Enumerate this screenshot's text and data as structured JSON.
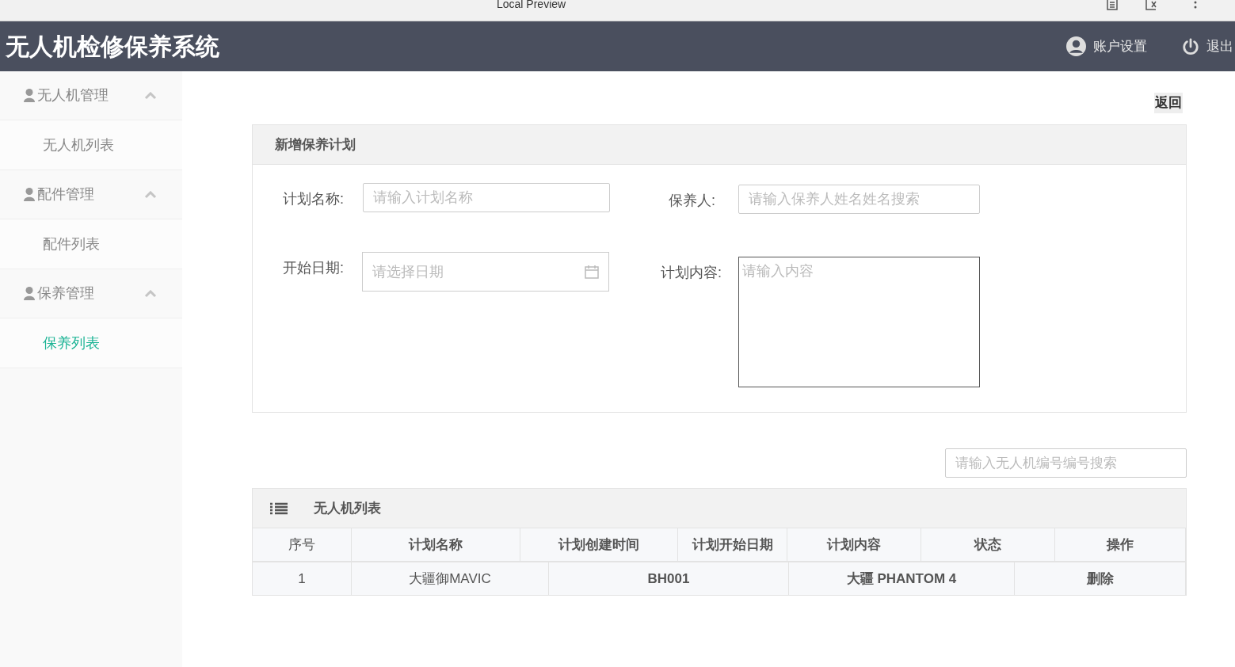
{
  "browser_bar": {
    "title": "Local Preview"
  },
  "header": {
    "title": "无人机检修保养系统",
    "account": "账户设置",
    "logout": "退出"
  },
  "sidebar": {
    "groups": [
      {
        "label": "无人机管理",
        "expanded": true,
        "children": [
          {
            "label": "无人机列表",
            "selected": false
          }
        ]
      },
      {
        "label": "配件管理",
        "expanded": true,
        "children": [
          {
            "label": "配件列表",
            "selected": false
          }
        ]
      },
      {
        "label": "保养管理",
        "expanded": true,
        "children": [
          {
            "label": "保养列表",
            "selected": true
          }
        ]
      }
    ]
  },
  "back_button": "返回",
  "form": {
    "title": "新增保养计划",
    "fields": [
      {
        "kind": "text",
        "label": "计划名称:",
        "placeholder": "请输入计划名称"
      },
      {
        "kind": "text",
        "label": "保养人:",
        "placeholder": "请输入保养人姓名姓名搜索"
      },
      {
        "kind": "date",
        "label": "开始日期:",
        "placeholder": "请选择日期"
      },
      {
        "kind": "textarea",
        "label": "计划内容:",
        "placeholder": "请输入内容"
      }
    ]
  },
  "search": {
    "placeholder": "请输入无人机编号编号搜索"
  },
  "table": {
    "title": "无人机列表",
    "header_cells": [
      "序号",
      "计划名称",
      "计划创建时间",
      "计划开始日期",
      "计划内容",
      "状态",
      "操作"
    ],
    "body_cells": [
      "1",
      "大疆御MAVIC",
      "BH001",
      "大疆 PHANTOM 4",
      "删除"
    ]
  }
}
